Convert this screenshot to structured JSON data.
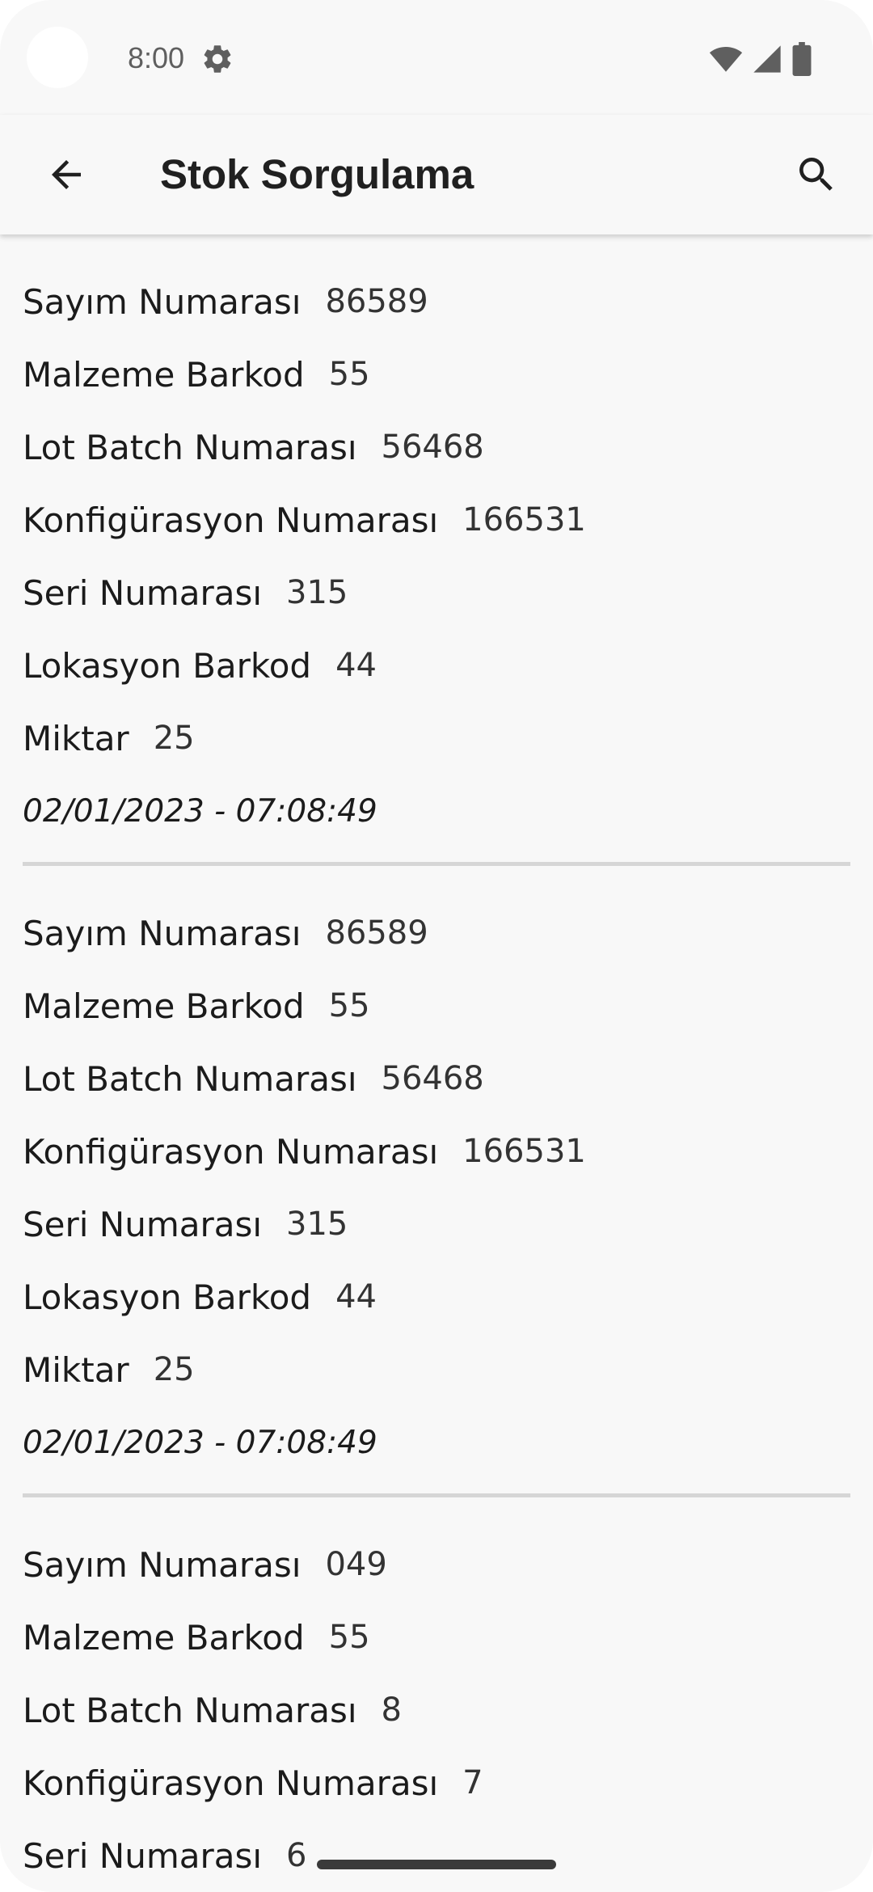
{
  "status_bar": {
    "time": "8:00",
    "icons": [
      "settings-icon",
      "wifi-icon",
      "cellular-signal-icon",
      "battery-icon"
    ]
  },
  "app_bar": {
    "title": "Stok Sorgulama",
    "back_icon": "arrow-left-icon",
    "search_icon": "search-icon"
  },
  "records": [
    {
      "fields": [
        {
          "label": "Sayım Numarası",
          "value": "86589"
        },
        {
          "label": "Malzeme Barkod",
          "value": "55"
        },
        {
          "label": "Lot Batch Numarası",
          "value": "56468"
        },
        {
          "label": "Konfigürasyon Numarası",
          "value": "166531"
        },
        {
          "label": "Seri Numarası",
          "value": "315"
        },
        {
          "label": "Lokasyon Barkod",
          "value": "44"
        },
        {
          "label": "Miktar",
          "value": "25"
        }
      ],
      "date": "02/01/2023 - 07:08:49"
    },
    {
      "fields": [
        {
          "label": "Sayım Numarası",
          "value": "86589"
        },
        {
          "label": "Malzeme Barkod",
          "value": "55"
        },
        {
          "label": "Lot Batch Numarası",
          "value": "56468"
        },
        {
          "label": "Konfigürasyon Numarası",
          "value": "166531"
        },
        {
          "label": "Seri Numarası",
          "value": "315"
        },
        {
          "label": "Lokasyon Barkod",
          "value": "44"
        },
        {
          "label": "Miktar",
          "value": "25"
        }
      ],
      "date": "02/01/2023 - 07:08:49"
    },
    {
      "fields": [
        {
          "label": "Sayım Numarası",
          "value": "049"
        },
        {
          "label": "Malzeme Barkod",
          "value": "55"
        },
        {
          "label": "Lot Batch Numarası",
          "value": "8"
        },
        {
          "label": "Konfigürasyon Numarası",
          "value": "7"
        },
        {
          "label": "Seri Numarası",
          "value": "6"
        }
      ],
      "date": ""
    }
  ],
  "colors": {
    "background": "#f8f8f8",
    "text": "#1b1b1b",
    "divider": "#d6d6d6"
  }
}
